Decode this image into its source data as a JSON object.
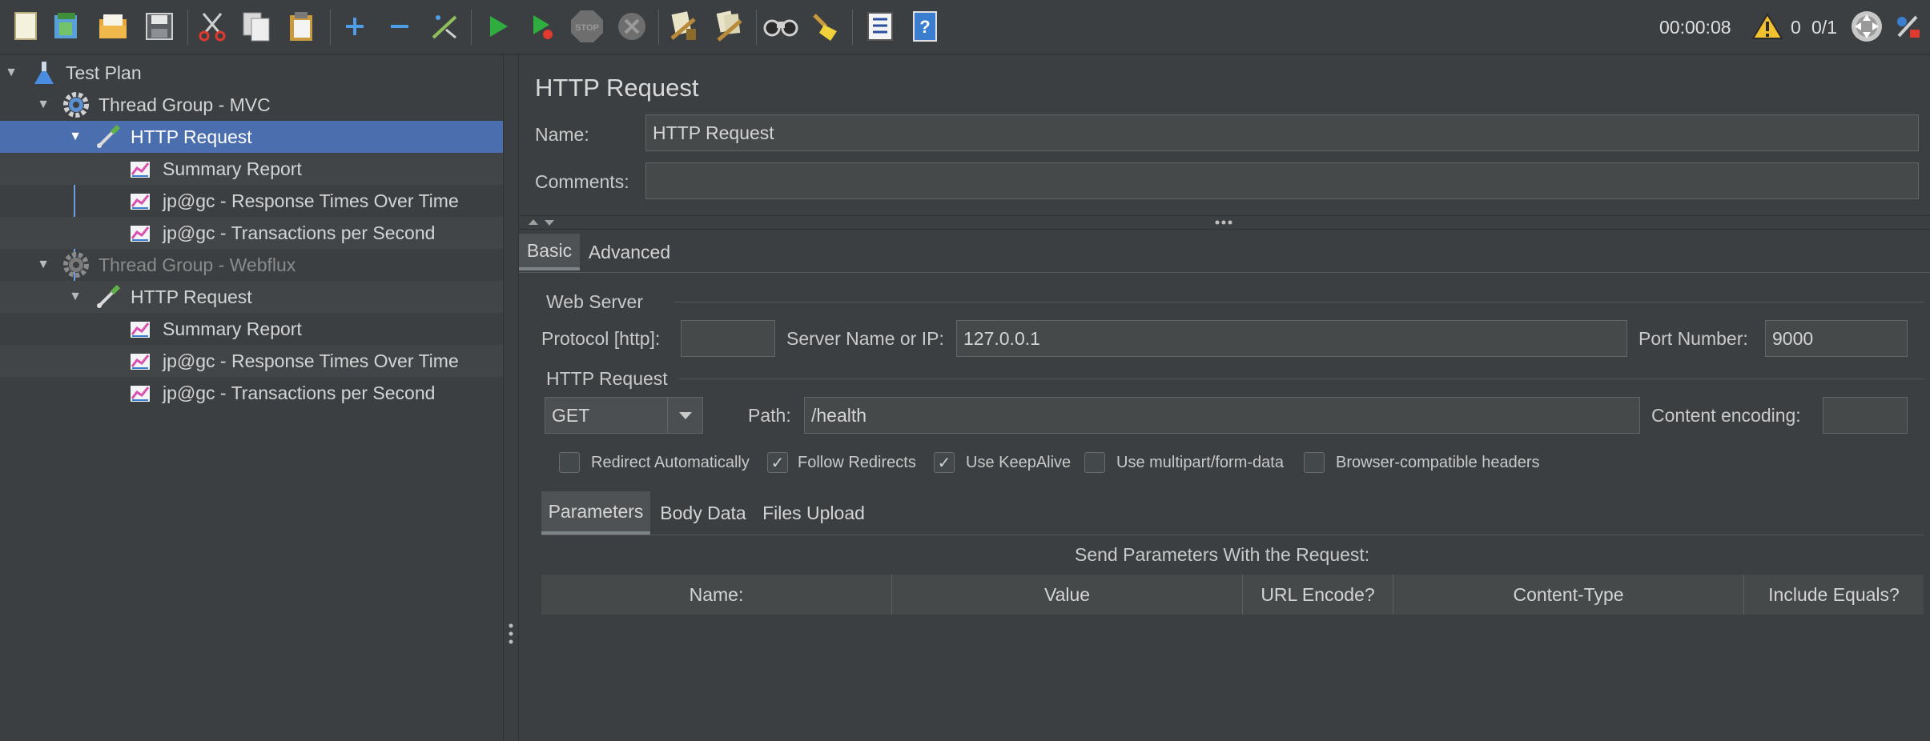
{
  "toolbar": {
    "timer": "00:00:08",
    "warning_count": "0",
    "thread_count": "0/1",
    "buttons": [
      {
        "name": "new-icon"
      },
      {
        "name": "templates-icon"
      },
      {
        "name": "open-icon"
      },
      {
        "name": "save-icon"
      },
      {
        "name": "cut-icon"
      },
      {
        "name": "copy-icon"
      },
      {
        "name": "paste-icon"
      },
      {
        "name": "expand-icon"
      },
      {
        "name": "collapse-icon"
      },
      {
        "name": "toggle-icon"
      },
      {
        "name": "start-icon"
      },
      {
        "name": "start-no-pauses-icon"
      },
      {
        "name": "stop-icon",
        "text": "STOP"
      },
      {
        "name": "shutdown-icon"
      },
      {
        "name": "clear-icon"
      },
      {
        "name": "clear-all-icon"
      },
      {
        "name": "search-icon"
      },
      {
        "name": "reset-search-icon"
      },
      {
        "name": "function-helper-icon"
      },
      {
        "name": "help-icon"
      }
    ]
  },
  "tree": {
    "items": [
      {
        "label": "Test Plan",
        "icon": "flask-icon"
      },
      {
        "label": "Thread Group - MVC",
        "icon": "gear-icon"
      },
      {
        "label": "HTTP Request",
        "icon": "pipette-icon"
      },
      {
        "label": "Summary Report",
        "icon": "graph-icon"
      },
      {
        "label": "jp@gc - Response Times Over Time",
        "icon": "graph-icon"
      },
      {
        "label": "jp@gc - Transactions per Second",
        "icon": "graph-icon"
      },
      {
        "label": "Thread Group - Webflux",
        "icon": "gear-icon"
      },
      {
        "label": "HTTP Request",
        "icon": "pipette-icon"
      },
      {
        "label": "Summary Report",
        "icon": "graph-icon"
      },
      {
        "label": "jp@gc - Response Times Over Time",
        "icon": "graph-icon"
      },
      {
        "label": "jp@gc - Transactions per Second",
        "icon": "graph-icon"
      }
    ]
  },
  "panel": {
    "title": "HTTP Request",
    "name_label": "Name:",
    "name_value": "HTTP Request",
    "comments_label": "Comments:",
    "comments_value": "",
    "tabs": [
      "Basic",
      "Advanced"
    ],
    "web_server": {
      "title": "Web Server",
      "protocol_label": "Protocol [http]:",
      "protocol_value": "",
      "server_label": "Server Name or IP:",
      "server_value": "127.0.0.1",
      "port_label": "Port Number:",
      "port_value": "9000"
    },
    "http_request": {
      "title": "HTTP Request",
      "method": "GET",
      "path_label": "Path:",
      "path_value": "/health",
      "encoding_label": "Content encoding:",
      "encoding_value": ""
    },
    "checkboxes": [
      {
        "label": "Redirect Automatically",
        "checked": false
      },
      {
        "label": "Follow Redirects",
        "checked": true
      },
      {
        "label": "Use KeepAlive",
        "checked": true
      },
      {
        "label": "Use multipart/form-data",
        "checked": false
      },
      {
        "label": "Browser-compatible headers",
        "checked": false
      }
    ],
    "sub_tabs": [
      "Parameters",
      "Body Data",
      "Files Upload"
    ],
    "params_caption": "Send Parameters With the Request:",
    "columns": [
      "Name:",
      "Value",
      "URL Encode?",
      "Content-Type",
      "Include Equals?"
    ]
  }
}
